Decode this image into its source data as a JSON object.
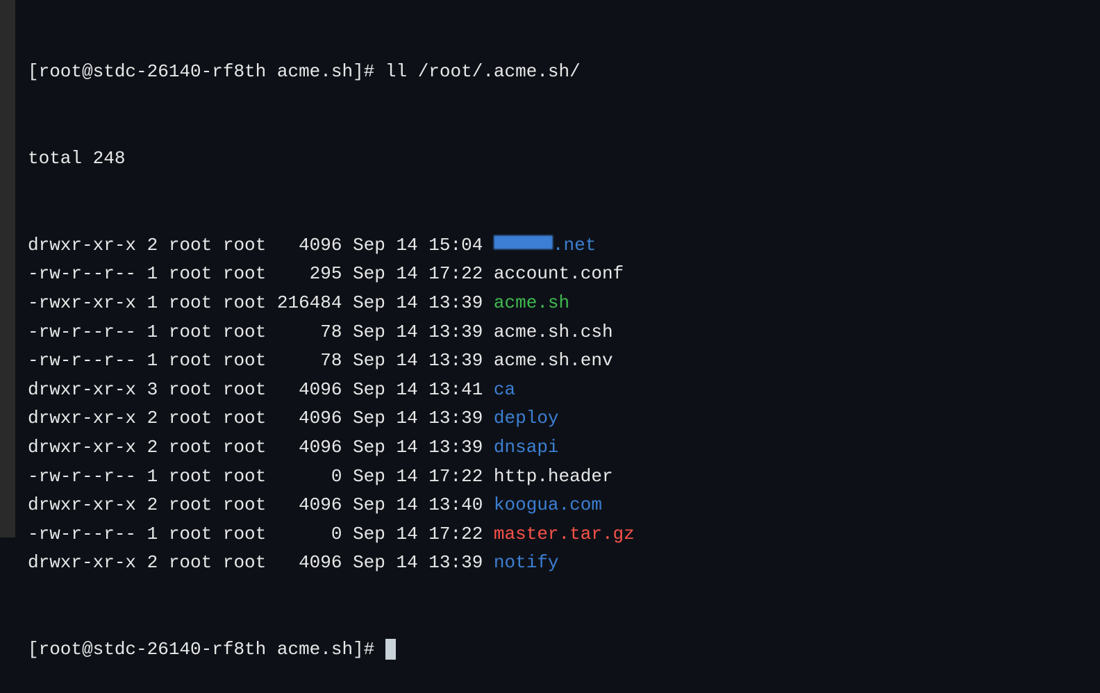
{
  "prompt1": {
    "prefix": "[root@stdc-26140-rf8th acme.sh]# ",
    "cmd": "ll /root/.acme.sh/"
  },
  "total": "total 248",
  "rows": [
    {
      "perm": "drwxr-xr-x",
      "links": "2",
      "owner": "root",
      "group": "root",
      "size": "  4096",
      "date": "Sep 14 15:04",
      "name": ".net",
      "type": "dir",
      "redacted": true
    },
    {
      "perm": "-rw-r--r--",
      "links": "1",
      "owner": "root",
      "group": "root",
      "size": "   295",
      "date": "Sep 14 17:22",
      "name": "account.conf",
      "type": "text"
    },
    {
      "perm": "-rwxr-xr-x",
      "links": "1",
      "owner": "root",
      "group": "root",
      "size": "216484",
      "date": "Sep 14 13:39",
      "name": "acme.sh",
      "type": "exec"
    },
    {
      "perm": "-rw-r--r--",
      "links": "1",
      "owner": "root",
      "group": "root",
      "size": "    78",
      "date": "Sep 14 13:39",
      "name": "acme.sh.csh",
      "type": "text"
    },
    {
      "perm": "-rw-r--r--",
      "links": "1",
      "owner": "root",
      "group": "root",
      "size": "    78",
      "date": "Sep 14 13:39",
      "name": "acme.sh.env",
      "type": "text"
    },
    {
      "perm": "drwxr-xr-x",
      "links": "3",
      "owner": "root",
      "group": "root",
      "size": "  4096",
      "date": "Sep 14 13:41",
      "name": "ca",
      "type": "dir"
    },
    {
      "perm": "drwxr-xr-x",
      "links": "2",
      "owner": "root",
      "group": "root",
      "size": "  4096",
      "date": "Sep 14 13:39",
      "name": "deploy",
      "type": "dir"
    },
    {
      "perm": "drwxr-xr-x",
      "links": "2",
      "owner": "root",
      "group": "root",
      "size": "  4096",
      "date": "Sep 14 13:39",
      "name": "dnsapi",
      "type": "dir"
    },
    {
      "perm": "-rw-r--r--",
      "links": "1",
      "owner": "root",
      "group": "root",
      "size": "     0",
      "date": "Sep 14 17:22",
      "name": "http.header",
      "type": "text"
    },
    {
      "perm": "drwxr-xr-x",
      "links": "2",
      "owner": "root",
      "group": "root",
      "size": "  4096",
      "date": "Sep 14 13:40",
      "name": "koogua.com",
      "type": "dir"
    },
    {
      "perm": "-rw-r--r--",
      "links": "1",
      "owner": "root",
      "group": "root",
      "size": "     0",
      "date": "Sep 14 17:22",
      "name": "master.tar.gz",
      "type": "archive"
    },
    {
      "perm": "drwxr-xr-x",
      "links": "2",
      "owner": "root",
      "group": "root",
      "size": "  4096",
      "date": "Sep 14 13:39",
      "name": "notify",
      "type": "dir"
    }
  ],
  "prompt2": {
    "prefix": "[root@stdc-26140-rf8th acme.sh]# "
  }
}
